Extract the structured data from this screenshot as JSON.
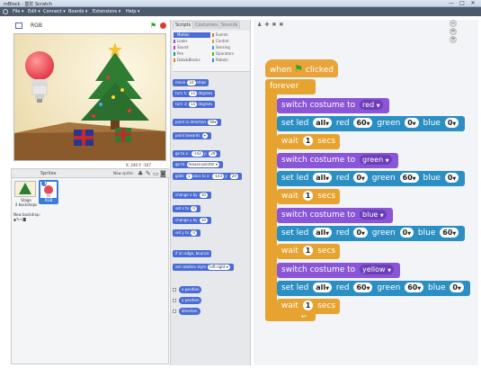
{
  "window": {
    "title": "mBlock - 基於 Scratch",
    "minimize": "—",
    "maximize": "□",
    "close": "✕"
  },
  "menu": [
    "File ▾",
    "Edit ▾",
    "Connect ▾",
    "Boards ▾",
    "Extensions ▾",
    "Help ▾"
  ],
  "stage": {
    "sprite_name": "RGB",
    "coords": "X: 240  Y: -167"
  },
  "sprites": {
    "header": "Sprites",
    "new_sprite": "New sprite:",
    "stage_label": "Stage\n4 backdrops",
    "new_backdrop": "New backdrop:",
    "sprite_thumb_label": "RGB",
    "sprite_number": "1"
  },
  "palette": {
    "tabs": [
      "Scripts",
      "Costumes",
      "Sounds"
    ],
    "categories": [
      {
        "label": "Motion",
        "color": "#4a6cd4",
        "selected": true
      },
      {
        "label": "Events",
        "color": "#c88330",
        "selected": false
      },
      {
        "label": "Looks",
        "color": "#8a55d7",
        "selected": false
      },
      {
        "label": "Control",
        "color": "#e1a91a",
        "selected": false
      },
      {
        "label": "Sound",
        "color": "#bb42c3",
        "selected": false
      },
      {
        "label": "Sensing",
        "color": "#2ca5e2",
        "selected": false
      },
      {
        "label": "Pen",
        "color": "#0e9a6c",
        "selected": false
      },
      {
        "label": "Operators",
        "color": "#5cb712",
        "selected": false
      },
      {
        "label": "Data&Blocks",
        "color": "#ee7d16",
        "selected": false
      },
      {
        "label": "Robots",
        "color": "#2b8fc4",
        "selected": false
      }
    ],
    "blocks": [
      {
        "pre": "move",
        "in1": "10",
        "post": "steps"
      },
      {
        "pre": "turn ↻",
        "in1": "15",
        "post": "degrees"
      },
      {
        "pre": "turn ↺",
        "in1": "15",
        "post": "degrees"
      },
      {
        "pre": "point in direction",
        "in1": "90▾",
        "post": ""
      },
      {
        "pre": "point towards",
        "in1": "▾",
        "post": ""
      },
      {
        "pre": "go to x:",
        "in1": "-143",
        "mid": "y:",
        "in2": "29",
        "post": ""
      },
      {
        "pre": "go to",
        "in1": "mouse-pointer ▾",
        "post": ""
      },
      {
        "pre": "glide",
        "in1": "1",
        "mid": "secs to x:",
        "in2": "-143",
        "mid2": "y:",
        "in3": "29",
        "post": ""
      },
      {
        "pre": "change x by",
        "in1": "10",
        "post": ""
      },
      {
        "pre": "set x to",
        "in1": "0",
        "post": ""
      },
      {
        "pre": "change y by",
        "in1": "10",
        "post": ""
      },
      {
        "pre": "set y to",
        "in1": "0",
        "post": ""
      },
      {
        "pre": "if on edge, bounce",
        "post": ""
      },
      {
        "pre": "set rotation style",
        "in1": "left-right ▾",
        "post": ""
      }
    ],
    "reporters": [
      "x position",
      "y position",
      "direction"
    ]
  },
  "script": {
    "hat": {
      "pre": "when",
      "post": "clicked"
    },
    "forever": "forever",
    "steps": [
      {
        "type": "looks",
        "text": "switch costume to",
        "value": "red"
      },
      {
        "type": "led",
        "pre": "set led",
        "which": "all",
        "r_label": "red",
        "r": "60",
        "g_label": "green",
        "g": "0",
        "b_label": "blue",
        "b": "0"
      },
      {
        "type": "wait",
        "pre": "wait",
        "value": "1",
        "post": "secs"
      },
      {
        "type": "looks",
        "text": "switch costume to",
        "value": "green"
      },
      {
        "type": "led",
        "pre": "set led",
        "which": "all",
        "r_label": "red",
        "r": "0",
        "g_label": "green",
        "g": "60",
        "b_label": "blue",
        "b": "0"
      },
      {
        "type": "wait",
        "pre": "wait",
        "value": "1",
        "post": "secs"
      },
      {
        "type": "looks",
        "text": "switch costume to",
        "value": "blue"
      },
      {
        "type": "led",
        "pre": "set led",
        "which": "all",
        "r_label": "red",
        "r": "0",
        "g_label": "green",
        "g": "0",
        "b_label": "blue",
        "b": "60"
      },
      {
        "type": "wait",
        "pre": "wait",
        "value": "1",
        "post": "secs"
      },
      {
        "type": "looks",
        "text": "switch costume to",
        "value": "yellow"
      },
      {
        "type": "led",
        "pre": "set led",
        "which": "all",
        "r_label": "red",
        "r": "60",
        "g_label": "green",
        "g": "60",
        "b_label": "blue",
        "b": "0"
      },
      {
        "type": "wait",
        "pre": "wait",
        "value": "1",
        "post": "secs"
      }
    ]
  },
  "colors": {
    "motion": "#4a6cd4",
    "looks": "#8a55d7",
    "robots": "#2b8fc4",
    "control": "#e6a330",
    "events": "#e8a43a"
  },
  "icons": {
    "green_flag": "flag-icon",
    "stop": "stop-icon",
    "globe": "globe-icon"
  }
}
